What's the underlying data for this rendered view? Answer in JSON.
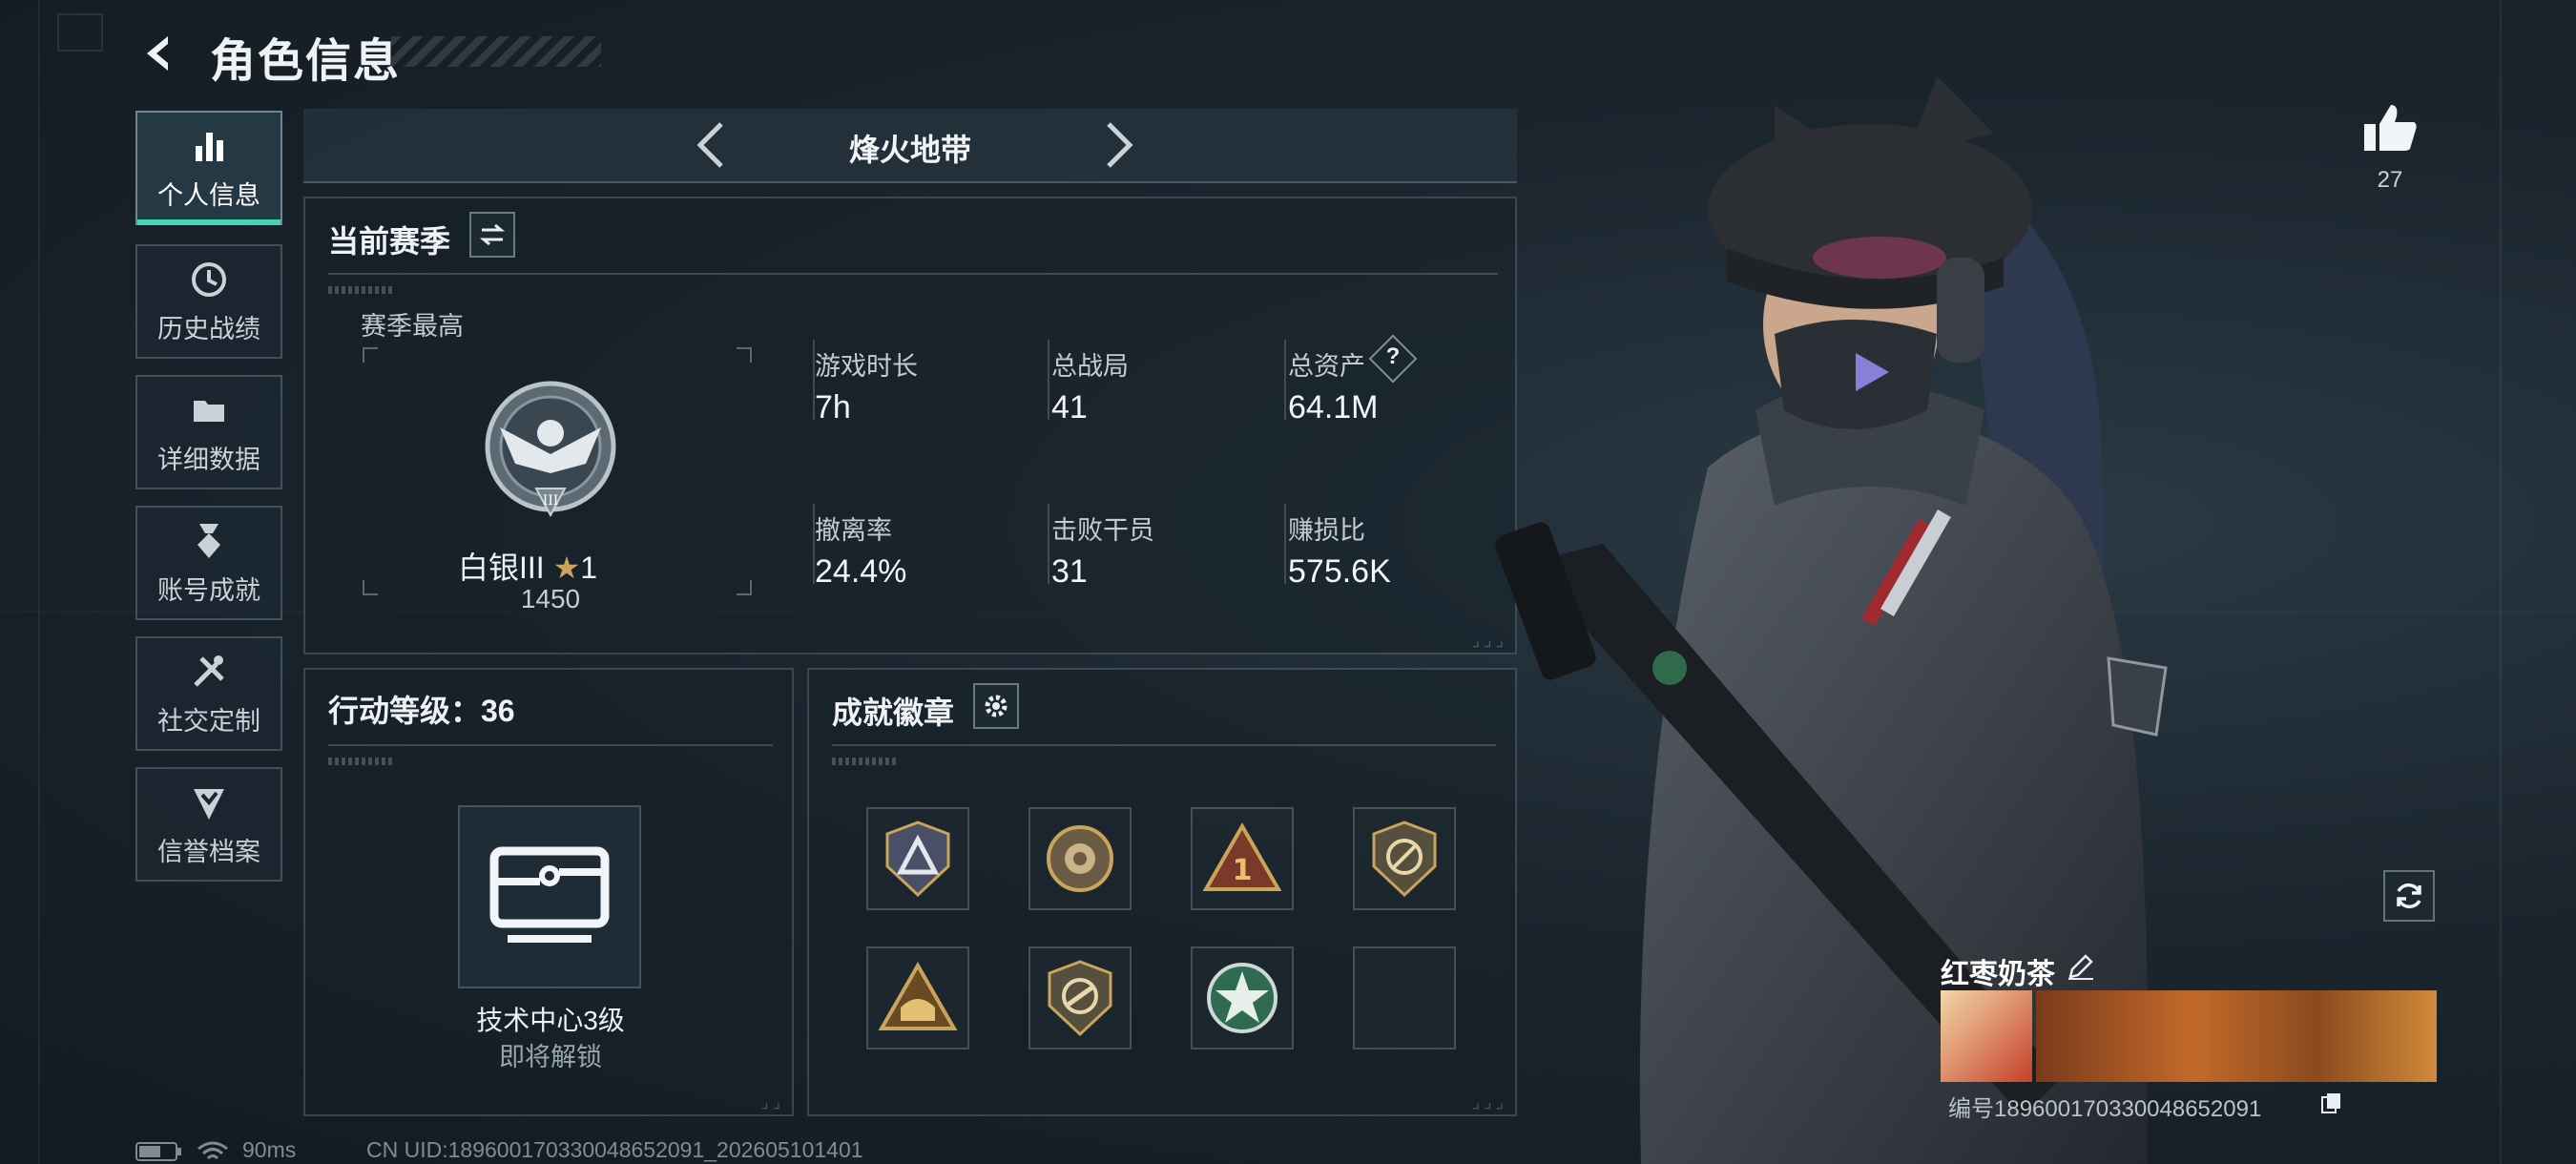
{
  "header": {
    "title": "角色信息"
  },
  "sidebar": {
    "items": [
      {
        "label": "个人信息",
        "icon": "bar-chart-icon",
        "active": true
      },
      {
        "label": "历史战绩",
        "icon": "history-clock-icon",
        "active": false
      },
      {
        "label": "详细数据",
        "icon": "folder-icon",
        "active": false
      },
      {
        "label": "账号成就",
        "icon": "medal-icon",
        "active": false
      },
      {
        "label": "社交定制",
        "icon": "tools-icon",
        "active": false
      },
      {
        "label": "信誉档案",
        "icon": "shield-check-icon",
        "active": false
      }
    ]
  },
  "mode_selector": {
    "label": "烽火地带"
  },
  "season": {
    "title": "当前赛季",
    "best_label": "赛季最高",
    "rank": {
      "name": "白银III",
      "stars": "1",
      "score": "1450"
    },
    "stats": [
      {
        "label": "游戏时长",
        "value": "7h"
      },
      {
        "label": "总战局",
        "value": "41"
      },
      {
        "label": "总资产",
        "value": "64.1M",
        "help": "?"
      },
      {
        "label": "撤离率",
        "value": "24.4%"
      },
      {
        "label": "击败干员",
        "value": "31"
      },
      {
        "label": "赚损比",
        "value": "575.6K"
      }
    ]
  },
  "action_level": {
    "title": "行动等级：36",
    "unlock_name": "技术中心3级",
    "unlock_status": "即将解锁"
  },
  "achievements": {
    "title": "成就徽章",
    "badges": [
      "triangle-badge",
      "rose-emblem-badge",
      "number-one-badge",
      "no-gun-shield-badge",
      "elephant-badge",
      "knife-shield-badge",
      "green-star-badge",
      "empty"
    ]
  },
  "profile": {
    "likes": "27",
    "nickname": "红枣奶茶",
    "id_line": "编号1896001703300486520​91"
  },
  "status_bar": {
    "ping": "90ms",
    "uid": "CN UID:18960017033004865209​1_202605101401"
  },
  "colors": {
    "accent": "#3fd6b4",
    "badge_gold": "#c9a45a"
  }
}
